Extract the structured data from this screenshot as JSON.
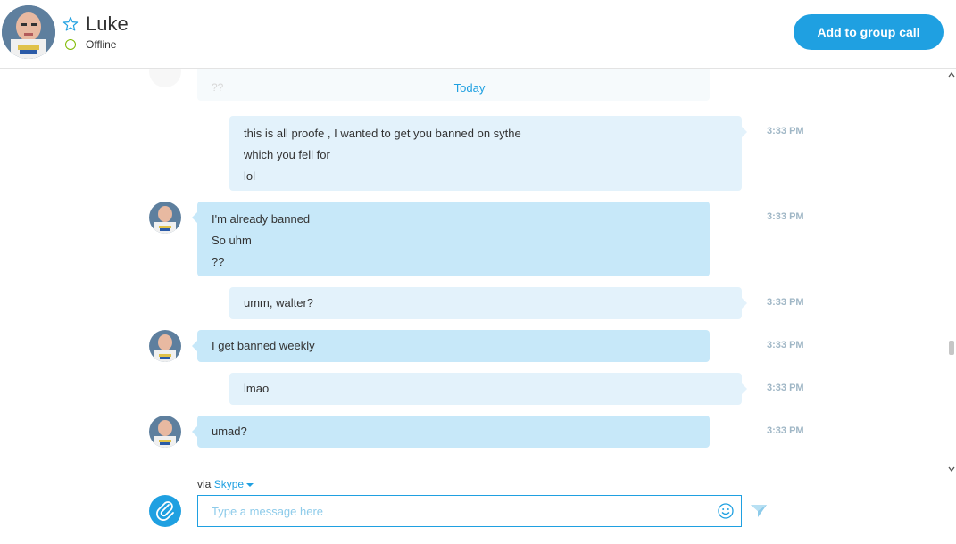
{
  "header": {
    "contact_name": "Luke",
    "status": "Offline",
    "add_call_label": "Add to group call"
  },
  "chat": {
    "date_divider": "Today",
    "messages": [
      {
        "direction": "outgoing",
        "lines": [
          "this is all proofe , I wanted to get you banned on sythe",
          "which you fell for",
          "lol"
        ],
        "time": "3:33 PM"
      },
      {
        "direction": "incoming",
        "lines": [
          "I'm already banned",
          "So uhm",
          "??"
        ],
        "time": "3:33 PM"
      },
      {
        "direction": "outgoing",
        "lines": [
          "umm, walter?"
        ],
        "time": "3:33 PM"
      },
      {
        "direction": "incoming",
        "lines": [
          "I get banned weekly"
        ],
        "time": "3:33 PM"
      },
      {
        "direction": "outgoing",
        "lines": [
          "lmao"
        ],
        "time": "3:33 PM"
      },
      {
        "direction": "incoming",
        "lines": [
          "umad?"
        ],
        "time": "3:33 PM"
      }
    ]
  },
  "composer": {
    "via_prefix": "via",
    "via_service": "Skype",
    "placeholder": "Type a message here"
  },
  "icons": {
    "favorite": "star-outline-icon",
    "status": "offline-ring-icon",
    "attach": "paperclip-icon",
    "emoji": "smiley-icon",
    "send": "send-arrow-icon",
    "dropdown": "chevron-down-icon"
  },
  "colors": {
    "accent": "#1fa0e1",
    "outgoing_bubble": "#e3f2fb",
    "incoming_bubble": "#c7e8f9",
    "status_offline": "#7fba00",
    "timestamp": "#a0b7c6"
  }
}
